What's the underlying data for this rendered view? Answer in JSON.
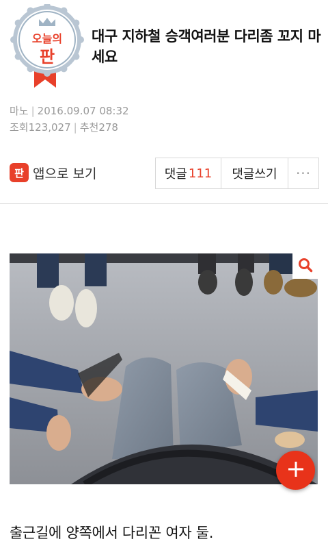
{
  "badge": {
    "label_top": "오늘의",
    "label_main": "판"
  },
  "post": {
    "title": "대구 지하철 승객여러분 다리좀 꼬지 마세요",
    "author": "마노",
    "date": "2016.09.07 08:32",
    "views_label": "조회",
    "views": "123,027",
    "recommend_label": "추천",
    "recommends": "278",
    "body": "출근길에 양쪽에서 다리꼰 여자 둘."
  },
  "actions": {
    "app_icon_text": "판",
    "app_view_label": "앱으로 보기",
    "comments_label": "댓글",
    "comments_count": "111",
    "write_comment_label": "댓글쓰기",
    "more_label": "···"
  },
  "icons": {
    "zoom": "search-icon",
    "fab": "plus-icon"
  },
  "colors": {
    "accent": "#e8402a",
    "badge_ring": "#9fb3c4",
    "meta_text": "#999999"
  }
}
